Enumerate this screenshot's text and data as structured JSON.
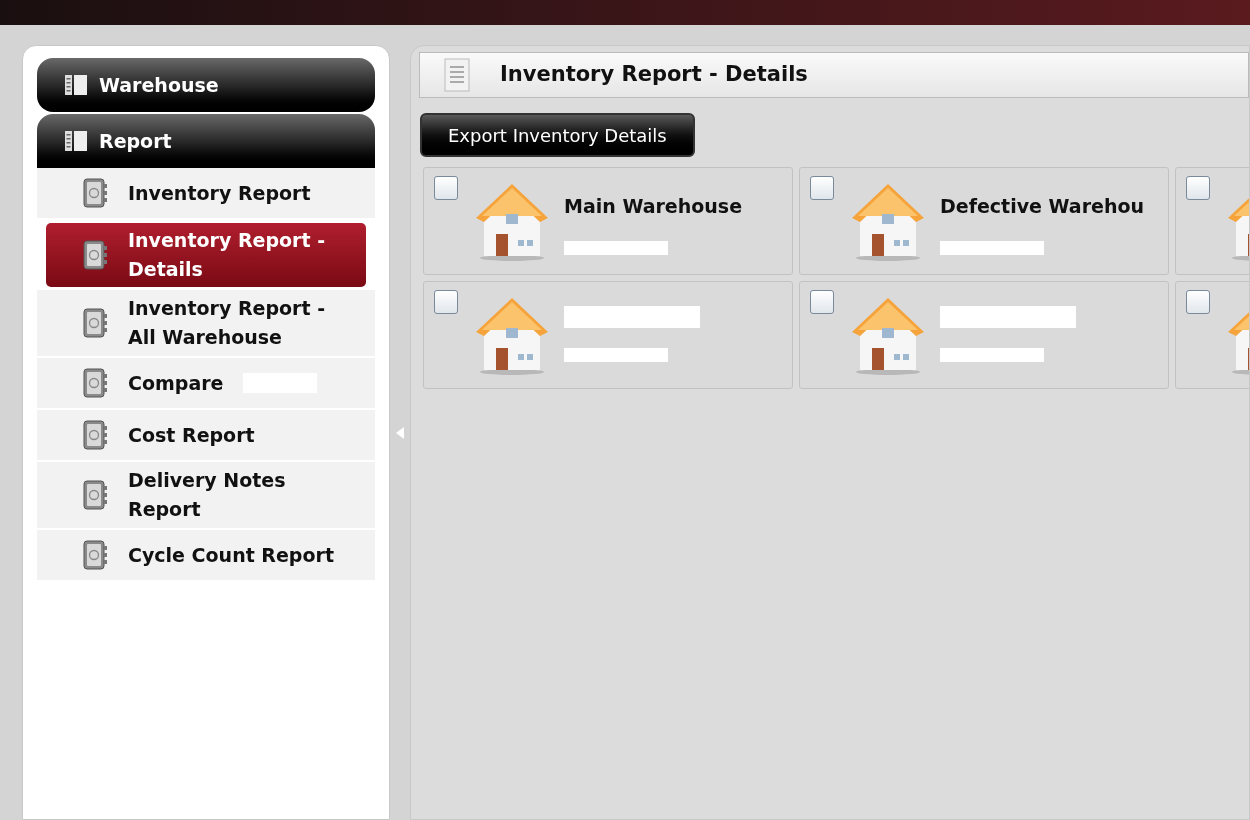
{
  "sidebar": {
    "sections": [
      {
        "label": "Warehouse",
        "expanded": false
      },
      {
        "label": "Report",
        "expanded": true
      }
    ],
    "items": [
      {
        "label": "Inventory Report",
        "selected": false,
        "redacted_suffix": false
      },
      {
        "label": "Inventory Report - Details",
        "selected": true,
        "redacted_suffix": false
      },
      {
        "label": "Inventory Report - All Warehouse",
        "selected": false,
        "redacted_suffix": false
      },
      {
        "label": "Compare",
        "selected": false,
        "redacted_suffix": true
      },
      {
        "label": "Cost Report",
        "selected": false,
        "redacted_suffix": false
      },
      {
        "label": "Delivery Notes Report",
        "selected": false,
        "redacted_suffix": false
      },
      {
        "label": "Cycle Count Report",
        "selected": false,
        "redacted_suffix": false
      }
    ]
  },
  "main": {
    "title": "Inventory Report - Details",
    "export_button": "Export Inventory Details",
    "warehouses": [
      {
        "name": "Main Warehouse",
        "checked": false
      },
      {
        "name": "Defective Warehou",
        "checked": false
      },
      {
        "checked": false
      },
      {
        "checked": false
      },
      {
        "checked": false
      },
      {
        "checked": false
      }
    ]
  }
}
